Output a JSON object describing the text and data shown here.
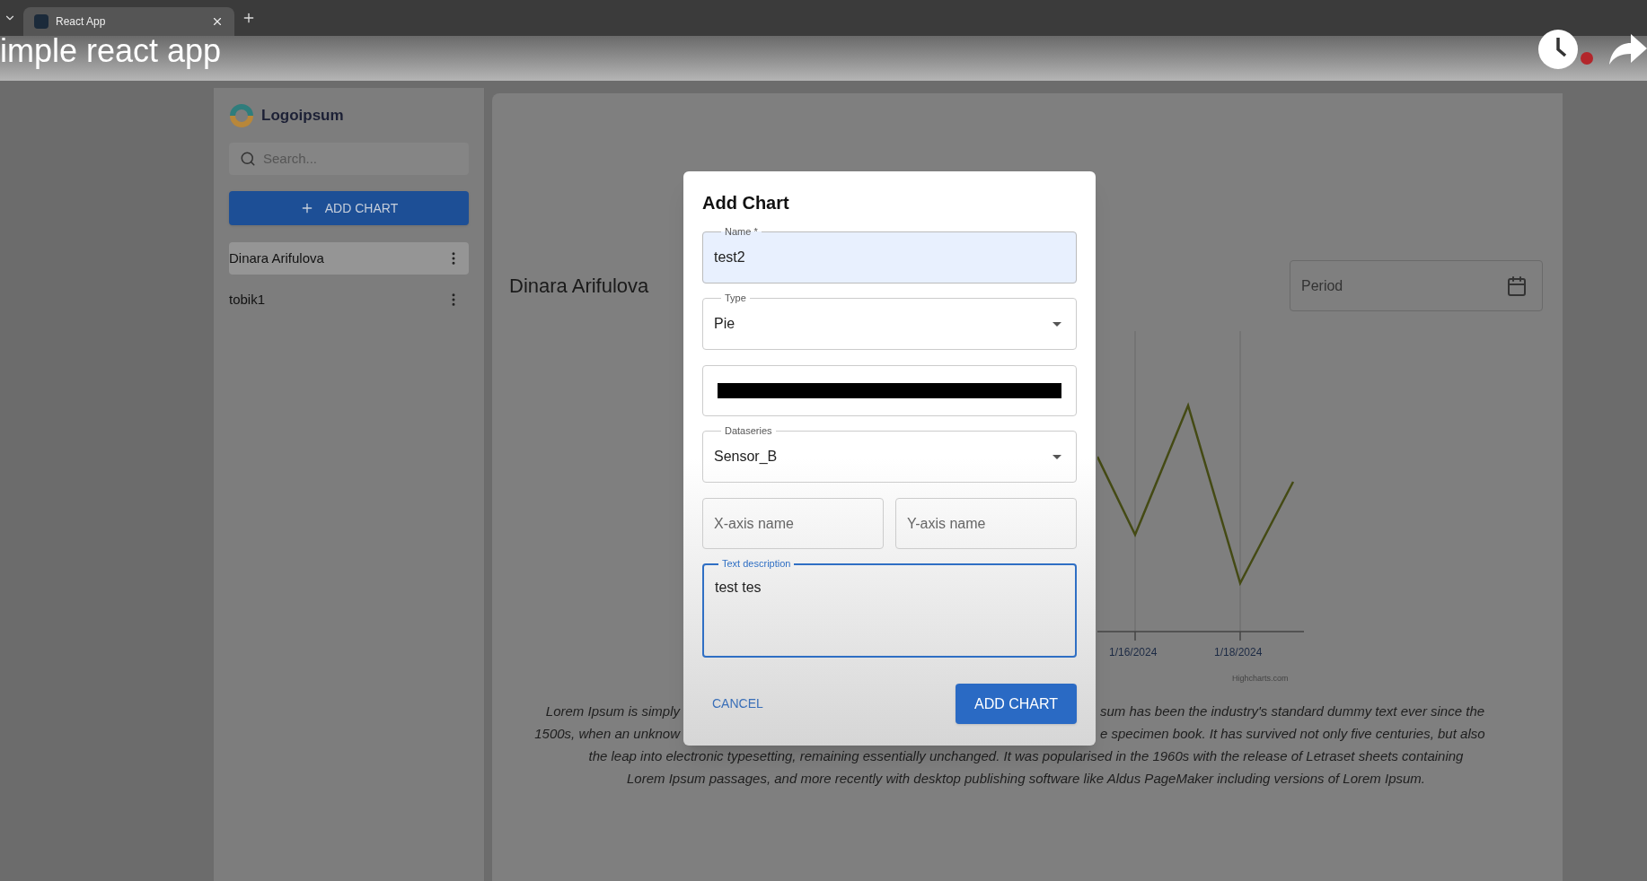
{
  "video_overlay": {
    "title": "imple react app"
  },
  "browser": {
    "tabs": [
      {
        "label": "React App",
        "selected": true
      }
    ]
  },
  "sidebar": {
    "logo": "Logoipsum",
    "search": {
      "placeholder": "Search..."
    },
    "add_button": "ADD CHART",
    "items": [
      {
        "label": "Dinara Arifulova",
        "selected": true
      },
      {
        "label": "tobik1",
        "selected": false
      }
    ]
  },
  "main": {
    "title": "Dinara Arifulova",
    "period": {
      "placeholder": "Period"
    },
    "chart": {
      "x_labels": [
        "1/16/2024",
        "1/18/2024"
      ],
      "credit": "Highcharts.com"
    },
    "description_lines": [
      [
        "Lorem Ipsum is simply",
        "sum has been the industry's standard dummy text ever since the"
      ],
      [
        "1500s, when an unknow",
        "e specimen book. It has survived not only five centuries, but also"
      ],
      [
        "the leap into electronic typesetting, remaining essentially unchanged. It was popularised in the 1960s with the release of Letraset sheets containing"
      ],
      [
        "Lorem Ipsum passages, and more recently with desktop publishing software like Aldus PageMaker including versions of Lorem Ipsum."
      ]
    ]
  },
  "dialog": {
    "title": "Add Chart",
    "fields": [
      {
        "kind": "text",
        "label": "Name *",
        "value": "test2",
        "autofilled": true
      },
      {
        "kind": "select",
        "label": "Type",
        "value": "Pie"
      },
      {
        "kind": "color",
        "color": "#000000"
      },
      {
        "kind": "select",
        "label": "Dataseries",
        "value": "Sensor_B"
      }
    ],
    "axis_fields": [
      {
        "placeholder": "X-axis name"
      },
      {
        "placeholder": "Y-axis name"
      }
    ],
    "description": {
      "label": "Text description",
      "value": "test tes",
      "focused": true
    },
    "cancel": "CANCEL",
    "submit": "ADD CHART"
  }
}
